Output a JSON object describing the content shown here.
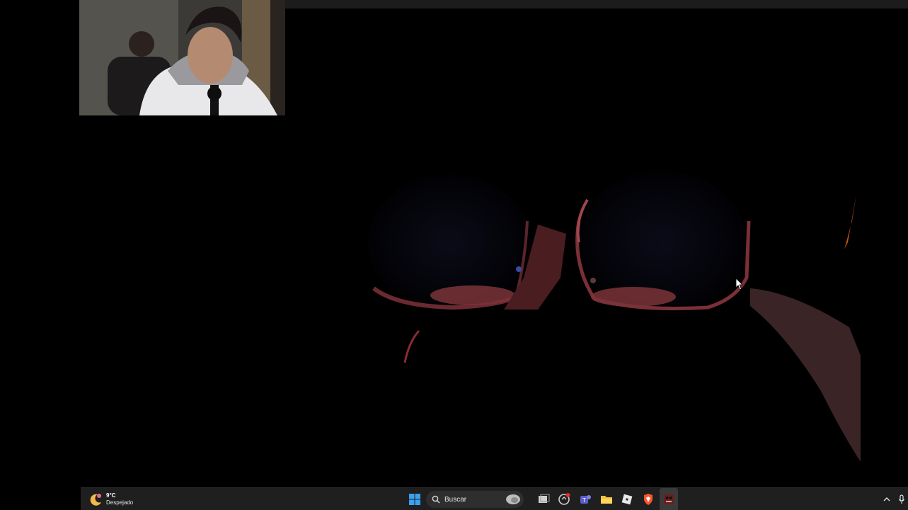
{
  "taskbar": {
    "weather": {
      "temperature": "9°C",
      "description": "Despejado",
      "icon": "moon-weather-icon"
    },
    "start_icon": "windows-start-icon",
    "search": {
      "label": "Buscar",
      "icon": "search-icon"
    },
    "pinned_apps": [
      {
        "name": "task-view-icon"
      },
      {
        "name": "copilot-icon"
      },
      {
        "name": "teams-icon"
      },
      {
        "name": "file-explorer-icon"
      },
      {
        "name": "roblox-icon"
      },
      {
        "name": "brave-browser-icon"
      },
      {
        "name": "game-app-icon",
        "active": true
      }
    ],
    "tray": {
      "chevron_icon": "chevron-up-icon",
      "mic_icon": "microphone-icon"
    }
  },
  "colors": {
    "taskbar_bg": "#1f1f1f",
    "game_bg": "#000000",
    "animatronic_red": "#8a3a40"
  }
}
